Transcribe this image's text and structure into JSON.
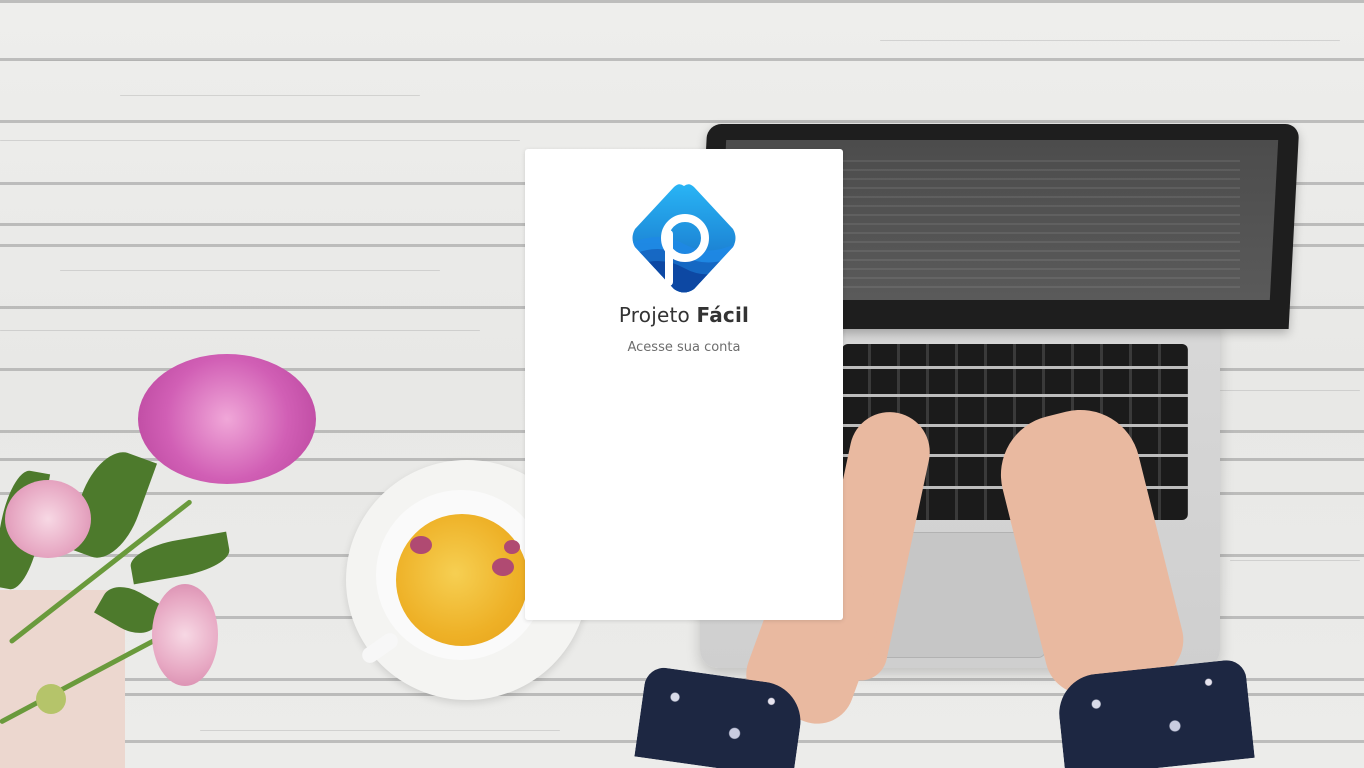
{
  "login_card": {
    "brand_regular": "Projeto",
    "brand_bold": "Fácil",
    "subtitle": "Acesse sua conta",
    "logo_icon": "projeto-facil-logo-icon"
  },
  "colors": {
    "card_background": "#ffffff",
    "logo_blue_light": "#29b6f6",
    "logo_blue_dark": "#0d47a1",
    "text_primary": "#333333",
    "text_secondary": "#6d6d6d"
  }
}
